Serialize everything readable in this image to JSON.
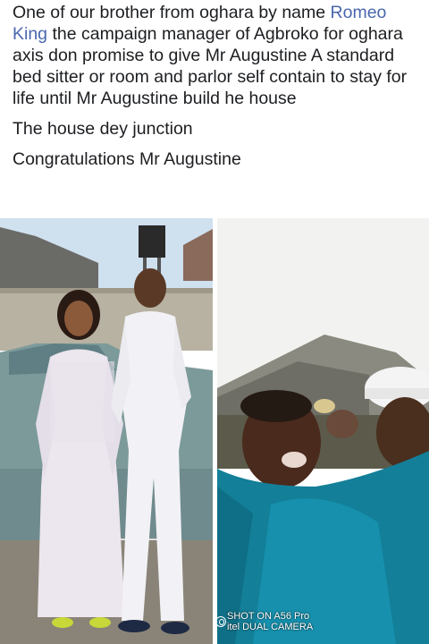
{
  "post": {
    "para1_before": "One of our brother from oghara by name ",
    "para1_mention": "Romeo King",
    "para1_after": " the campaign manager of Agbroko for oghara axis don promise to give Mr Augustine A standard bed sitter or room and parlor self contain to stay for life until Mr Augustine build he house",
    "para2": "The house dey junction",
    "para3": "Congratulations Mr Augustine"
  },
  "photos": {
    "left_alt": "couple-photo",
    "right_alt": "crowd-photo",
    "watermark_line1": "SHOT ON A56 Pro",
    "watermark_line2": "itel DUAL CAMERA"
  },
  "colors": {
    "mention": "#4a67ad",
    "text": "#1c1e21"
  }
}
